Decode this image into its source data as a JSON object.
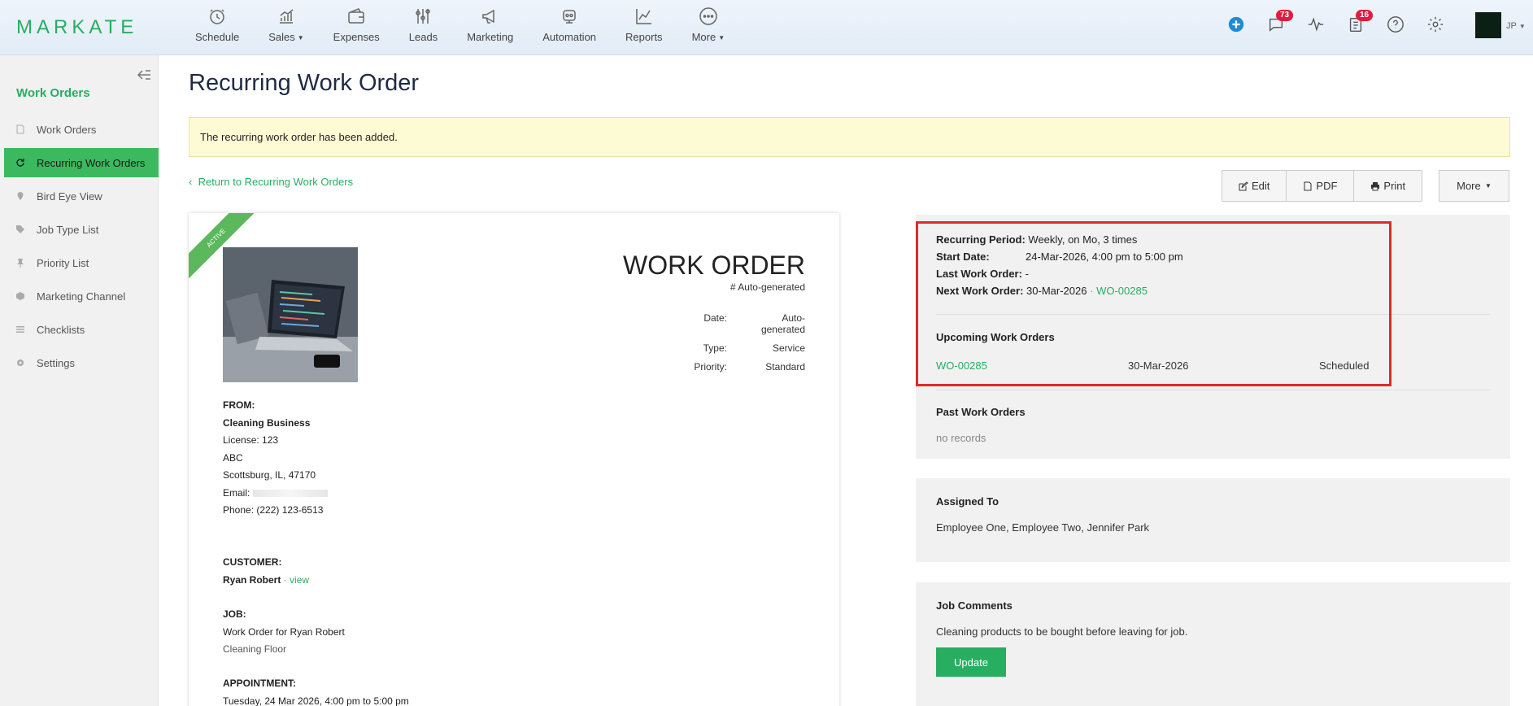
{
  "app": {
    "logo": "MARKATE"
  },
  "nav": [
    {
      "label": "Schedule",
      "icon": "clock-icon",
      "caret": false
    },
    {
      "label": "Sales",
      "icon": "sales-chart-icon",
      "caret": true
    },
    {
      "label": "Expenses",
      "icon": "wallet-icon",
      "caret": false
    },
    {
      "label": "Leads",
      "icon": "sliders-icon",
      "caret": false
    },
    {
      "label": "Marketing",
      "icon": "megaphone-icon",
      "caret": false
    },
    {
      "label": "Automation",
      "icon": "robot-icon",
      "caret": false
    },
    {
      "label": "Reports",
      "icon": "line-chart-icon",
      "caret": false
    },
    {
      "label": "More",
      "icon": "ellipsis-icon",
      "caret": true
    }
  ],
  "topbar": {
    "messages_badge": "73",
    "tasks_badge": "16",
    "user_initials": "JP"
  },
  "sidebar": {
    "title": "Work Orders",
    "items": [
      {
        "label": "Work Orders",
        "icon": "document-icon",
        "active": false
      },
      {
        "label": "Recurring Work Orders",
        "icon": "refresh-icon",
        "active": true
      },
      {
        "label": "Bird Eye View",
        "icon": "map-pin-icon",
        "active": false
      },
      {
        "label": "Job Type List",
        "icon": "tag-icon",
        "active": false
      },
      {
        "label": "Priority List",
        "icon": "pushpin-icon",
        "active": false
      },
      {
        "label": "Marketing Channel",
        "icon": "cube-icon",
        "active": false
      },
      {
        "label": "Checklists",
        "icon": "list-icon",
        "active": false
      },
      {
        "label": "Settings",
        "icon": "gear-icon",
        "active": false
      }
    ]
  },
  "page": {
    "title": "Recurring Work Order",
    "alert": "The recurring work order has been added.",
    "return_link": "Return to Recurring Work Orders",
    "buttons": {
      "edit": "Edit",
      "pdf": "PDF",
      "print": "Print",
      "more": "More"
    }
  },
  "document": {
    "ribbon": "ACTIVE",
    "title": "WORK ORDER",
    "number": "# Auto-generated",
    "meta": [
      {
        "k": "Date:",
        "v": "Auto-generated"
      },
      {
        "k": "Type:",
        "v": "Service"
      },
      {
        "k": "Priority:",
        "v": "Standard"
      }
    ],
    "from_label": "FROM:",
    "from_name": "Cleaning Business",
    "from_license": "License: 123",
    "from_line1": "ABC",
    "from_line2": "Scottsburg, IL, 47170",
    "from_email": "Email: ",
    "from_phone": "Phone: (222) 123-6513",
    "customer_label": "CUSTOMER:",
    "customer_name": "Ryan Robert",
    "customer_sep": "·",
    "customer_view": "view",
    "job_label": "JOB:",
    "job_name": "Work Order for Ryan Robert",
    "job_type": "Cleaning Floor",
    "appt_label": "APPOINTMENT:",
    "appt_value": "Tuesday, 24 Mar 2026, 4:00 pm to 5:00 pm"
  },
  "recurrence": {
    "period_label": "Recurring Period:",
    "period_value": "Weekly, on Mo, 3 times",
    "start_label": "Start Date:",
    "start_value": "24-Mar-2026, 4:00 pm to 5:00 pm",
    "last_label": "Last Work Order:",
    "last_value": "-",
    "next_label": "Next Work Order:",
    "next_date": "30-Mar-2026",
    "next_sep": "·",
    "next_wo": "WO-00285",
    "upcoming_title": "Upcoming Work Orders",
    "upcoming": [
      {
        "wo": "WO-00285",
        "date": "30-Mar-2026",
        "status": "Scheduled"
      }
    ],
    "past_title": "Past Work Orders",
    "past_empty": "no records"
  },
  "assigned": {
    "title": "Assigned To",
    "value": "Employee One, Employee Two, Jennifer Park"
  },
  "comments": {
    "title": "Job Comments",
    "value": "Cleaning products to be bought before leaving for job.",
    "button": "Update"
  },
  "colors": {
    "brand_green": "#27ae60",
    "highlight_red": "#e02a2a",
    "alert_bg": "#fdfbd3"
  }
}
